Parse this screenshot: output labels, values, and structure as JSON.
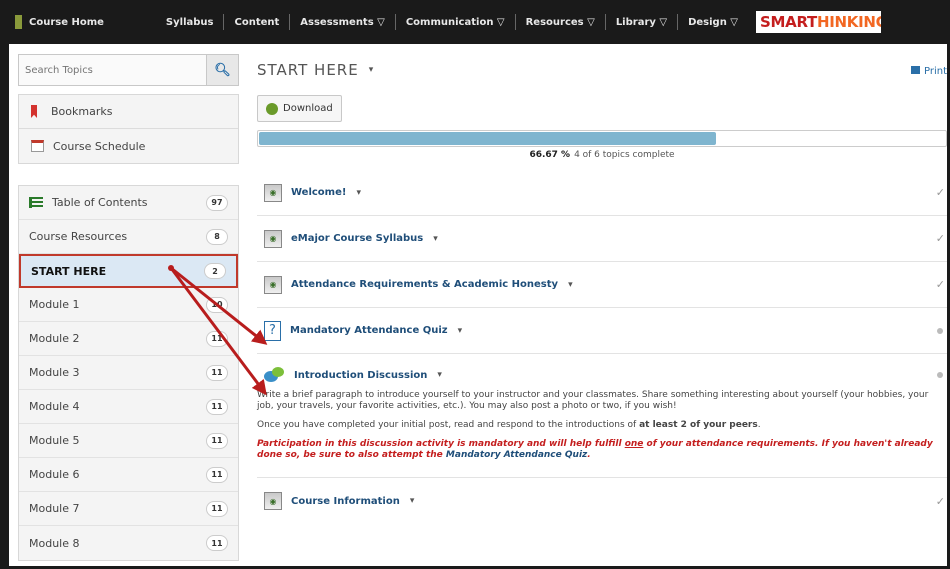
{
  "navbar": {
    "home": "Course Home",
    "items": [
      "Syllabus",
      "Content",
      "Assessments ▽",
      "Communication ▽",
      "Resources ▽",
      "Library ▽",
      "Design ▽"
    ],
    "smart_a": "SMART",
    "smart_b": "HINKING"
  },
  "sidebar": {
    "search_placeholder": "Search Topics",
    "search_icon": "search-icon",
    "bookmarks": "Bookmarks",
    "schedule": "Course Schedule",
    "toc": [
      {
        "label": "Table of Contents",
        "count": "97"
      },
      {
        "label": "Course Resources",
        "count": "8"
      },
      {
        "label": "START HERE",
        "count": "2"
      },
      {
        "label": "Module 1",
        "count": "10"
      },
      {
        "label": "Module 2",
        "count": "11"
      },
      {
        "label": "Module 3",
        "count": "11"
      },
      {
        "label": "Module 4",
        "count": "11"
      },
      {
        "label": "Module 5",
        "count": "11"
      },
      {
        "label": "Module 6",
        "count": "11"
      },
      {
        "label": "Module 7",
        "count": "11"
      },
      {
        "label": "Module 8",
        "count": "11"
      }
    ]
  },
  "main": {
    "title": "START HERE",
    "caret": "▾",
    "print": "Print",
    "download": "Download",
    "progress": {
      "percent_label": "66.67 %",
      "detail": "4 of 6 topics complete",
      "fraction": 0.6667
    },
    "topics": [
      {
        "title": "Welcome!",
        "status": "✓"
      },
      {
        "title": "eMajor Course Syllabus",
        "status": "✓"
      },
      {
        "title": "Attendance Requirements & Academic Honesty",
        "status": "✓"
      },
      {
        "title": "Mandatory Attendance Quiz",
        "status": ""
      },
      {
        "title": "Introduction Discussion",
        "status": ""
      },
      {
        "title": "Course Information",
        "status": "✓"
      }
    ],
    "discussion": {
      "p1": "Write a brief paragraph to introduce yourself to your instructor and your classmates.  Share something interesting about yourself (your hobbies, your job, your travels, your favorite activities, etc.). You may also post a photo or two, if you wish!",
      "p2_a": "Once you have completed your initial post, read and respond to the introductions of ",
      "p2_b": "at least 2 of your peers",
      "p2_c": ".",
      "p3_a": "Participation in this discussion activity is mandatory and will help fulfill ",
      "p3_b": "one",
      "p3_c": " of your attendance requirements. If you haven't already done so, be sure to also attempt the ",
      "p3_d": "Mandatory Attendance Quiz",
      "p3_e": "."
    },
    "colors": {
      "accent": "#1f4e79",
      "highlight": "#c0392b",
      "progress": "#7fb5cf"
    }
  }
}
